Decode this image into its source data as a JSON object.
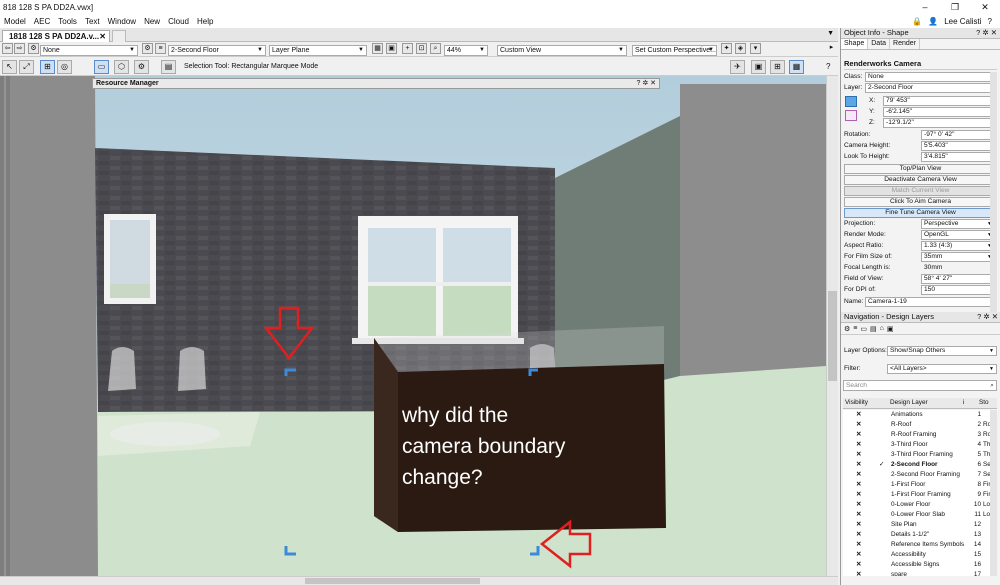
{
  "window": {
    "title": "818 128 S PA DD2A.vwx]"
  },
  "menu": [
    "Model",
    "AEC",
    "Tools",
    "Text",
    "Window",
    "New",
    "Cloud",
    "Help"
  ],
  "user": {
    "name": "Lee Calisti"
  },
  "doc_tab": {
    "label": "1818 128 S PA DD2A.v..."
  },
  "viewbar": {
    "class_value": "None",
    "layer_value": "2-Second Floor",
    "plane_value": "Layer Plane",
    "zoom_value": "44%",
    "view_value": "Custom View",
    "perspective_value": "Set Custom Perspective..."
  },
  "toolbar": {
    "mode_label": "Selection Tool: Rectangular Marquee Mode"
  },
  "resource_manager": {
    "title": "Resource Manager",
    "controls": "? ✲ ✕"
  },
  "annotation": {
    "text_line1": "why did the",
    "text_line2": "camera boundary",
    "text_line3": "change?"
  },
  "object_info": {
    "title": "Object Info - Shape",
    "tabs": [
      "Shape",
      "Data",
      "Render"
    ],
    "object_type": "Renderworks Camera",
    "class_label": "Class:",
    "class_value": "None",
    "layer_label": "Layer:",
    "layer_value": "2-Second Floor",
    "x_label": "X:",
    "x_value": "79' 453\"",
    "y_label": "Y:",
    "y_value": "-6'2.145\"",
    "z_label": "Z:",
    "z_value": "-12'9.1/2\"",
    "rotation_label": "Rotation:",
    "rotation_value": "-97° 0' 42\"",
    "camera_height_label": "Camera Height:",
    "camera_height_value": "5'5.403\"",
    "look_height_label": "Look To Height:",
    "look_height_value": "3'4.815\"",
    "buttons": [
      "Top/Plan View",
      "Deactivate Camera View",
      "Match Current View",
      "Click To Aim Camera",
      "Fine Tune Camera View"
    ],
    "projection_label": "Projection:",
    "projection_value": "Perspective",
    "render_mode_label": "Render Mode:",
    "render_mode_value": "OpenGL",
    "aspect_label": "Aspect Ratio:",
    "aspect_value": "1.33 (4:3)",
    "film_label": "For Film Size of:",
    "film_value": "35mm",
    "focal_label": "Focal Length is:",
    "focal_value": "30mm",
    "fov_label": "Field of View:",
    "fov_value": "58° 4' 27\"",
    "dpi_label": "For DPI of:",
    "dpi_value": "150",
    "name_label": "Name:",
    "name_value": "Camera-1-19"
  },
  "navigation": {
    "title": "Navigation - Design Layers",
    "layer_options_label": "Layer Options:",
    "layer_options_value": "Show/Snap Others",
    "filter_label": "Filter:",
    "filter_value": "<All Layers>",
    "search_placeholder": "Search",
    "col_visibility": "Visibility",
    "col_design_layer": "Design Layer",
    "col_num": "i",
    "col_story": "Sto",
    "layers": [
      {
        "name": "Animations",
        "num": "1",
        "story": ""
      },
      {
        "name": "R-Roof",
        "num": "2",
        "story": "Ro"
      },
      {
        "name": "R-Roof Framing",
        "num": "3",
        "story": "Ro"
      },
      {
        "name": "3-Third Floor",
        "num": "4",
        "story": "Thi"
      },
      {
        "name": "3-Third Floor Framing",
        "num": "5",
        "story": "Thi"
      },
      {
        "name": "2-Second Floor",
        "num": "6",
        "story": "Sec"
      },
      {
        "name": "2-Second Floor Framing",
        "num": "7",
        "story": "Sec"
      },
      {
        "name": "1-First Floor",
        "num": "8",
        "story": "Firs"
      },
      {
        "name": "1-First Floor Framing",
        "num": "9",
        "story": "Firs"
      },
      {
        "name": "0-Lower Floor",
        "num": "10",
        "story": "Low"
      },
      {
        "name": "0-Lower Floor Slab",
        "num": "11",
        "story": "Low"
      },
      {
        "name": "Site Plan",
        "num": "12",
        "story": ""
      },
      {
        "name": "Details 1-1/2\"",
        "num": "13",
        "story": ""
      },
      {
        "name": "Reference Items Symbols",
        "num": "14",
        "story": ""
      },
      {
        "name": "Accessibility",
        "num": "15",
        "story": ""
      },
      {
        "name": "Accessible Signs",
        "num": "16",
        "story": ""
      },
      {
        "name": "spare",
        "num": "17",
        "story": ""
      }
    ]
  },
  "colors": {
    "accent": "#3c8ad8",
    "arrow": "#e02020",
    "wall": "#4e4d54",
    "note_box": "#2a1a12"
  }
}
